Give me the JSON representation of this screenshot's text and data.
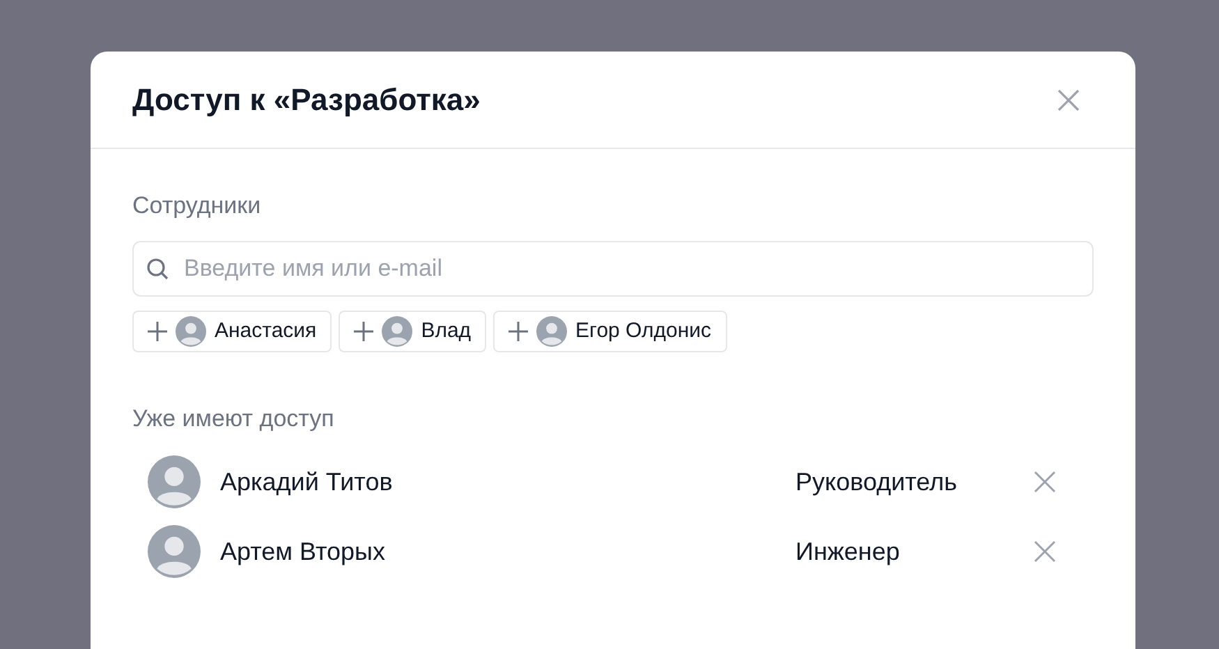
{
  "dialog": {
    "title": "Доступ к «Разработка»"
  },
  "employees": {
    "label": "Сотрудники",
    "search": {
      "placeholder": "Введите имя или e-mail"
    },
    "suggestions": [
      {
        "name": "Анастасия"
      },
      {
        "name": "Влад"
      },
      {
        "name": "Егор Олдонис"
      }
    ]
  },
  "access": {
    "label": "Уже имеют доступ",
    "members": [
      {
        "name": "Аркадий Титов",
        "role": "Руководитель"
      },
      {
        "name": "Артем Вторых",
        "role": "Инженер"
      }
    ]
  }
}
